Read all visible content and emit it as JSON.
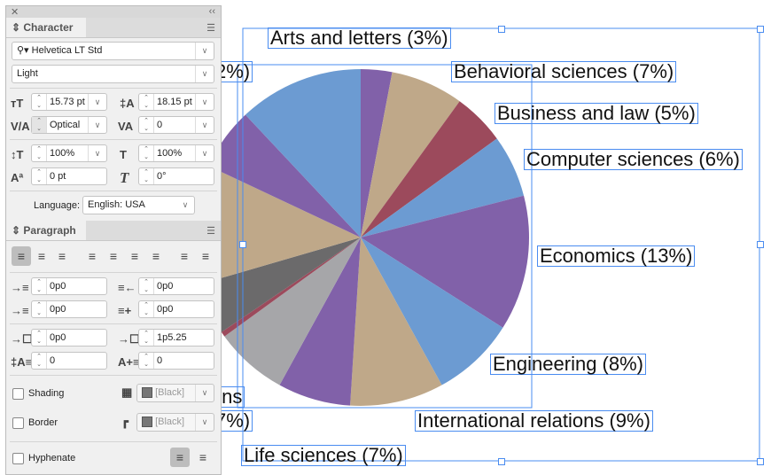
{
  "chart": {
    "colors": {
      "blue": "#6c9bd2",
      "purple": "#8161a9",
      "tan": "#bfa889",
      "maroon": "#9c4a5c",
      "gray": "#a6a6a9",
      "darkgray": "#6b6a6b"
    },
    "slices": [
      {
        "label": "Arts and letters (3%)",
        "value": 3,
        "color": "purple"
      },
      {
        "label": "Behavioral sciences (7%)",
        "value": 7,
        "color": "tan"
      },
      {
        "label": "Business and law (5%)",
        "value": 5,
        "color": "maroon"
      },
      {
        "label": "Computer sciences (6%)",
        "value": 6,
        "color": "blue"
      },
      {
        "label": "Economics (13%)",
        "value": 13,
        "color": "purple"
      },
      {
        "label": "Engineering (8%)",
        "value": 8,
        "color": "blue"
      },
      {
        "label": "International relations (9%)",
        "value": 9,
        "color": "tan"
      },
      {
        "label": "Life sciences (7%)",
        "value": 7,
        "color": "purple"
      },
      {
        "label": "",
        "value": 7,
        "color": "gray"
      },
      {
        "label": "",
        "value": 0.5,
        "color": "maroon"
      },
      {
        "label": "",
        "value": 5,
        "color": "darkgray"
      },
      {
        "label": "",
        "value": 11.5,
        "color": "tan"
      },
      {
        "label": "",
        "value": 6,
        "color": "purple"
      },
      {
        "label": "",
        "value": 12,
        "color": "blue"
      }
    ],
    "partial_labels": [
      "2%)",
      "ions",
      "7%)"
    ]
  },
  "character": {
    "tab": "Character",
    "font": "Helvetica LT Std",
    "style": "Light",
    "size": "15.73 pt",
    "leading": "18.15 pt",
    "kerning": "Optical",
    "tracking": "0",
    "vscale": "100%",
    "hscale": "100%",
    "baseline": "0 pt",
    "skew": "0°",
    "language_label": "Language:",
    "language": "English: USA"
  },
  "paragraph": {
    "tab": "Paragraph",
    "left_indent": "0p0",
    "right_indent": "0p0",
    "first_indent": "0p0",
    "last_indent": "0p0",
    "space_before": "0p0",
    "space_after": "1p5.25",
    "dropcap_lines": "0",
    "dropcap_chars": "0",
    "shading": "Shading",
    "border": "Border",
    "swatch": "[Black]",
    "hyphenate": "Hyphenate"
  }
}
